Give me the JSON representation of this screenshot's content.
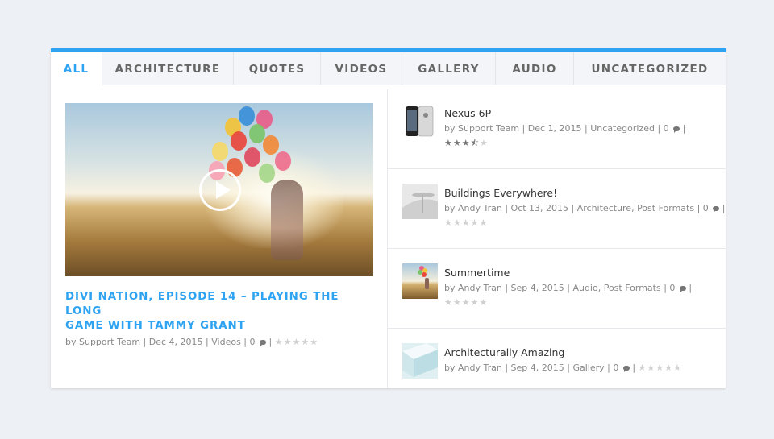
{
  "tabs": [
    "ALL",
    "ARCHITECTURE",
    "QUOTES",
    "VIDEOS",
    "GALLERY",
    "AUDIO",
    "UNCATEGORIZED"
  ],
  "active_tab": "ALL",
  "featured": {
    "title_line1": "DIVI NATION, EPISODE 14 – PLAYING THE LONG",
    "title_line2": "GAME WITH TAMMY GRANT",
    "by": "by",
    "author": "Support Team",
    "date": "Dec 4, 2015",
    "category": "Videos",
    "comments": "0",
    "rating": 0
  },
  "posts": [
    {
      "title": "Nexus 6P",
      "author": "Support Team",
      "date": "Dec 1, 2015",
      "categories": "Uncategorized",
      "comments": "0",
      "rating": 3.5,
      "thumb": "phone"
    },
    {
      "title": "Buildings Everywhere!",
      "author": "Andy Tran",
      "date": "Oct 13, 2015",
      "categories": "Architecture, Post Formats",
      "comments": "0",
      "rating": 0,
      "thumb": "building"
    },
    {
      "title": "Summertime",
      "author": "Andy Tran",
      "date": "Sep 4, 2015",
      "categories": "Audio, Post Formats",
      "comments": "0",
      "rating": 0,
      "thumb": "summer"
    },
    {
      "title": "Architecturally Amazing",
      "author": "Andy Tran",
      "date": "Sep 4, 2015",
      "categories": "Gallery",
      "comments": "0",
      "rating": 0,
      "thumb": "arch"
    }
  ],
  "colors": {
    "accent": "#2ea3f2",
    "background": "#edf0f4"
  }
}
